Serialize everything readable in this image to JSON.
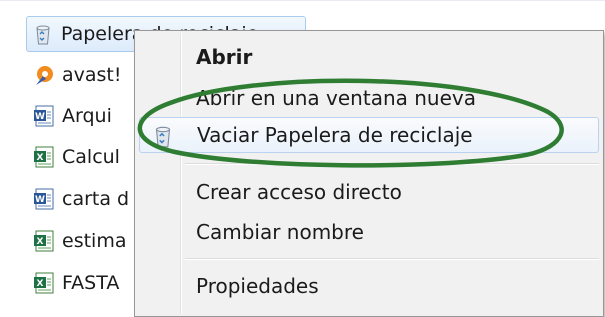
{
  "desktop": {
    "items": [
      {
        "label": "Papelera de reciclaje",
        "icon": "recycle-bin-icon",
        "selected": true
      },
      {
        "label": "avast!",
        "icon": "avast-icon"
      },
      {
        "label": "Arqui",
        "icon": "word-document-icon"
      },
      {
        "label": "Calcul",
        "icon": "excel-spreadsheet-icon"
      },
      {
        "label": "carta d",
        "icon": "word-document-icon"
      },
      {
        "label": "estima",
        "icon": "excel-spreadsheet-icon"
      },
      {
        "label": "FASTA",
        "icon": "excel-spreadsheet-icon"
      }
    ]
  },
  "context_menu": {
    "items": [
      {
        "label": "Abrir",
        "bold": true
      },
      {
        "label": "Abrir en una ventana nueva"
      },
      {
        "label": "Vaciar Papelera de reciclaje",
        "icon": "recycle-bin-icon",
        "highlighted": true,
        "circled": true
      },
      {
        "label": "Crear acceso directo"
      },
      {
        "label": "Cambiar nombre"
      },
      {
        "label": "Propiedades"
      }
    ]
  },
  "colors": {
    "selection_fill": "#dcebfb",
    "selection_border": "#a9cbee",
    "menu_background": "#f1f1f1",
    "annotation_ellipse": "#2e7d32"
  }
}
